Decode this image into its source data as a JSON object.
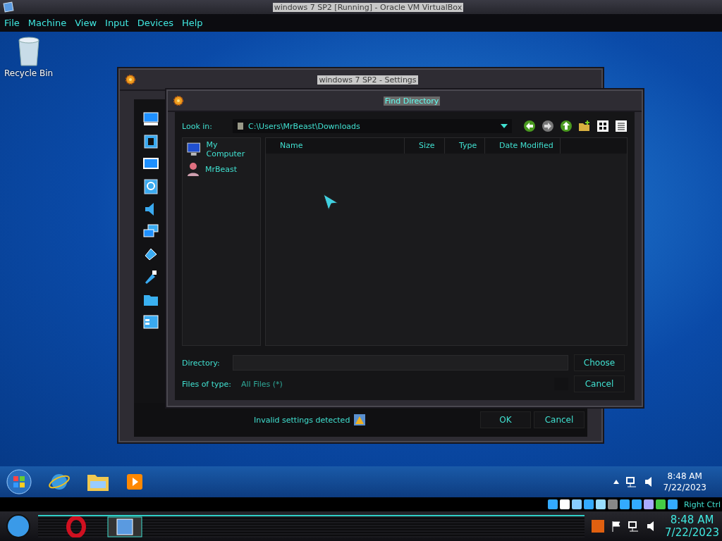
{
  "vm_window": {
    "title": "windows 7 SP2 [Running] - Oracle VM VirtualBox"
  },
  "menu_bar": [
    "File",
    "Machine",
    "View",
    "Input",
    "Devices",
    "Help"
  ],
  "desktop_icons": [
    {
      "label": "Recycle Bin"
    }
  ],
  "settings_window": {
    "title": "windows 7 SP2 - Settings",
    "status": "Invalid settings detected",
    "buttons": [
      "OK",
      "Cancel"
    ]
  },
  "find_dialog": {
    "title": "Find Directory",
    "look_in_label": "Look in:",
    "look_in_value": "C:\\Users\\MrBeast\\Downloads",
    "places": [
      {
        "kind": "computer",
        "label": "My Computer"
      },
      {
        "kind": "user",
        "label": "MrBeast"
      }
    ],
    "columns": [
      "Name",
      "Size",
      "Type",
      "Date Modified"
    ],
    "directory_label": "Directory:",
    "files_of_type_label": "Files of type:",
    "files_of_type": "All Files (*)",
    "buttons": [
      "Choose",
      "Cancel"
    ]
  },
  "guest_taskbar": {
    "time": "8:48 AM",
    "date": "7/22/2023"
  },
  "vm_status_bar": {
    "host_key": "Right Ctrl"
  },
  "host_taskbar": {
    "time": "8:48 AM",
    "date": "7/22/2023"
  }
}
